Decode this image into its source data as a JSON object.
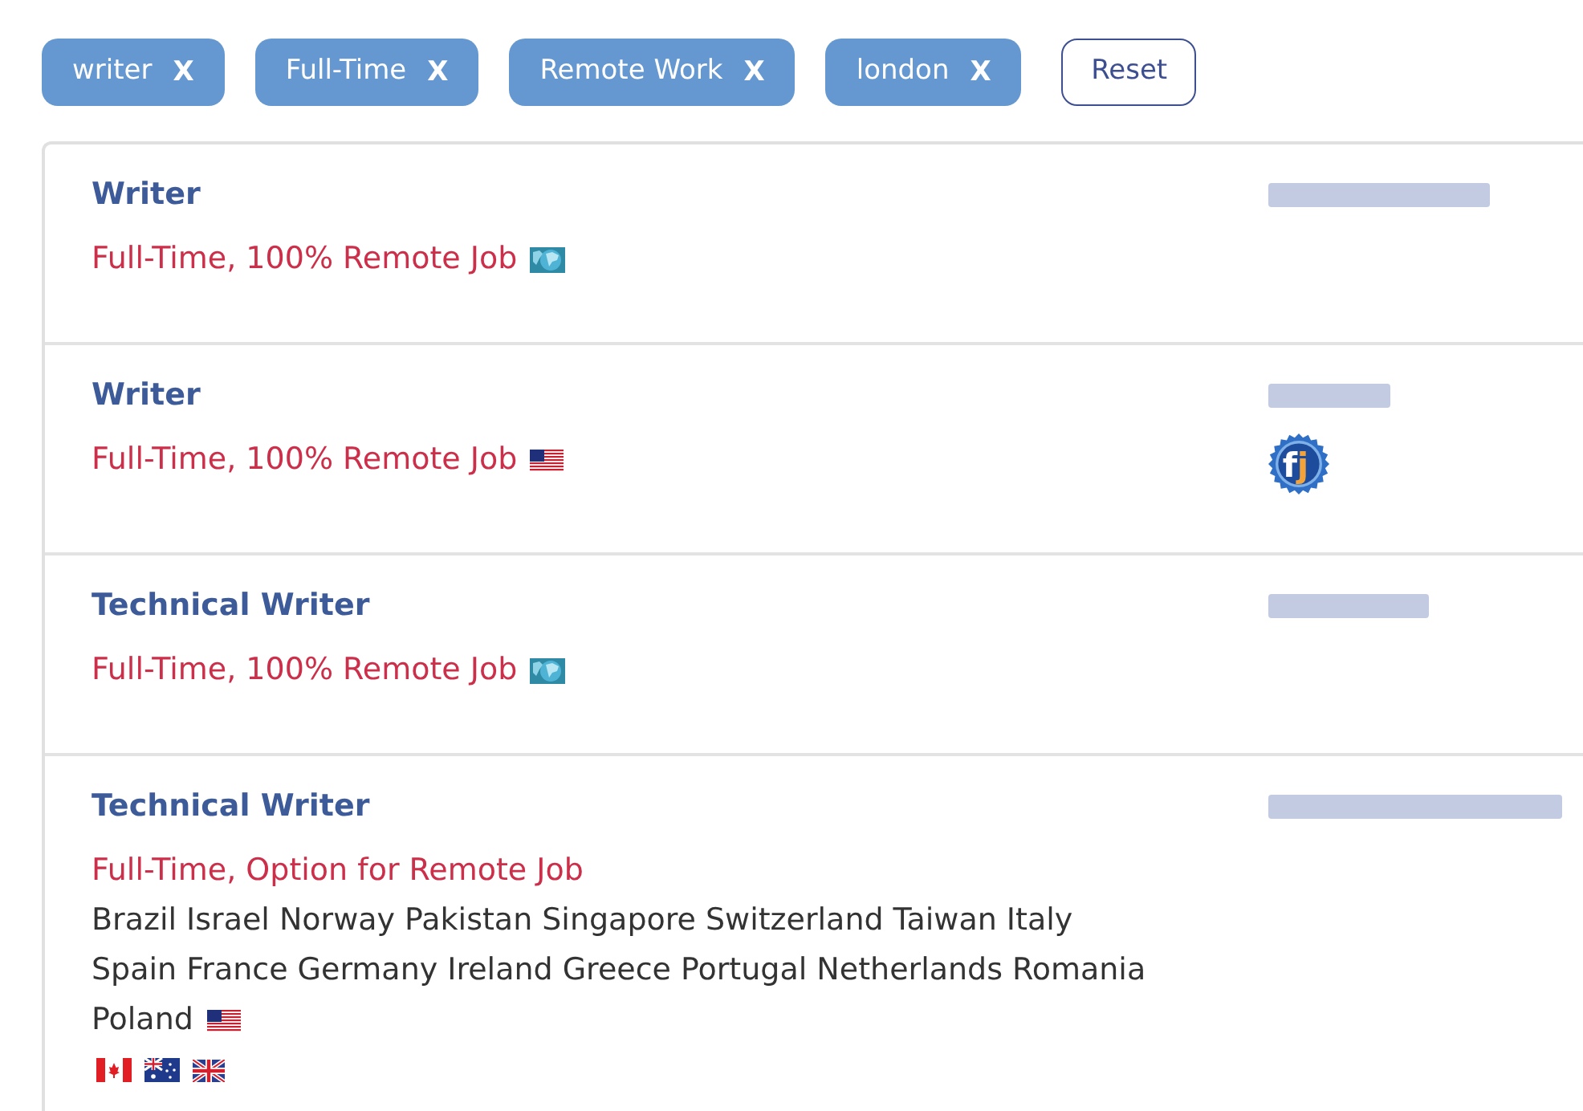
{
  "filters": [
    {
      "label": "writer",
      "remove": "X"
    },
    {
      "label": "Full-Time",
      "remove": "X"
    },
    {
      "label": "Remote Work",
      "remove": "X"
    },
    {
      "label": "london",
      "remove": "X"
    }
  ],
  "reset": "Reset",
  "jobs": [
    {
      "title": "Writer",
      "type": "Full-Time, 100% Remote Job",
      "flags": [
        {
          "kind": "world"
        }
      ],
      "company": {
        "kind": "blurred"
      }
    },
    {
      "title": "Writer",
      "type": "Full-Time, 100% Remote Job",
      "flags": [
        {
          "kind": "us"
        }
      ],
      "company": {
        "kind": "blurred"
      },
      "badge": {
        "letters": [
          {
            "char": "f",
            "color": "#ffffff"
          },
          {
            "char": "j",
            "color": "#f2a33a"
          }
        ]
      }
    },
    {
      "title": "Technical Writer",
      "type": "Full-Time, 100% Remote Job",
      "flags": [
        {
          "kind": "world"
        }
      ],
      "company": {
        "kind": "blurred"
      }
    },
    {
      "title": "Technical Writer",
      "type": "Full-Time, Option for Remote Job",
      "locations": [
        "Brazil",
        "Israel",
        "Norway",
        "Pakistan",
        "Singapore",
        "Switzerland",
        "Taiwan",
        "Italy",
        "Spain",
        "France",
        "Germany",
        "Ireland",
        "Greece",
        "Portugal",
        "Netherlands",
        "Romania",
        "Poland"
      ],
      "flags": [
        {
          "kind": "us"
        }
      ],
      "extra_flags": [
        {
          "kind": "ca"
        },
        {
          "kind": "au"
        },
        {
          "kind": "gb"
        }
      ],
      "company": {
        "kind": "blurred"
      }
    }
  ]
}
